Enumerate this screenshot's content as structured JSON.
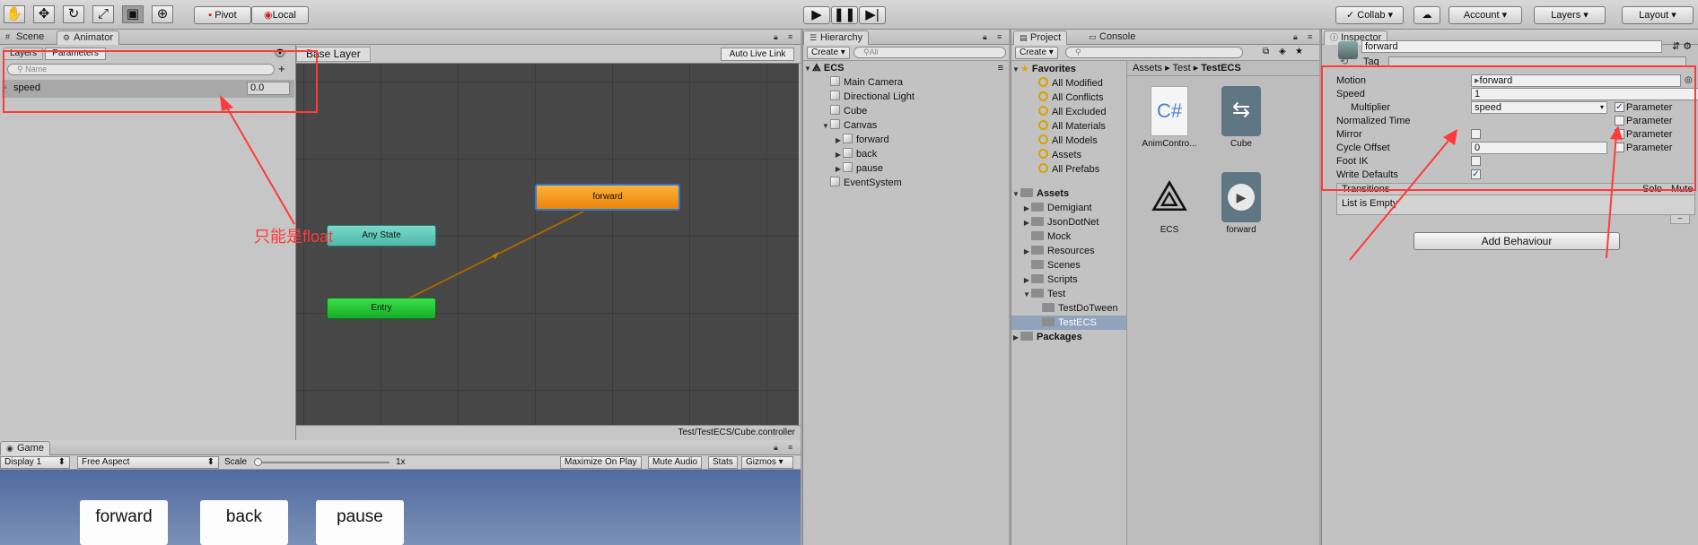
{
  "toolbar": {
    "tools": [
      "hand-tool",
      "move-tool",
      "rotate-tool",
      "scale-tool",
      "rect-tool",
      "transform-tool"
    ],
    "pivot": "Pivot",
    "local": "Local",
    "collab": "Collab",
    "account": "Account",
    "layers": "Layers",
    "layout": "Layout"
  },
  "left_tabs": {
    "scene": "Scene",
    "animator": "Animator"
  },
  "animator": {
    "layers_tab": "Layers",
    "parameters_tab": "Parameters",
    "search_placeholder": "Name",
    "param_name": "speed",
    "param_value": "0.0",
    "breadcrumb": "Base Layer",
    "auto_live_link": "Auto Live Link",
    "states": {
      "forward": "forward",
      "any_state": "Any State",
      "entry": "Entry"
    },
    "footer_path": "Test/TestECS/Cube.controller",
    "annotation": "只能是float"
  },
  "game": {
    "tab": "Game",
    "display": "Display 1",
    "aspect": "Free Aspect",
    "scale_label": "Scale",
    "scale_value": "1x",
    "maximize": "Maximize On Play",
    "mute": "Mute Audio",
    "stats": "Stats",
    "gizmos": "Gizmos",
    "buttons": [
      "forward",
      "back",
      "pause"
    ]
  },
  "hierarchy": {
    "tab": "Hierarchy",
    "create": "Create",
    "search_placeholder": "All",
    "scene": "ECS",
    "items": [
      "Main Camera",
      "Directional Light",
      "Cube",
      "Canvas",
      "forward",
      "back",
      "pause",
      "EventSystem"
    ]
  },
  "project": {
    "tab": "Project",
    "console_tab": "Console",
    "create": "Create",
    "favorites": "Favorites",
    "fav_items": [
      "All Modified",
      "All Conflicts",
      "All Excluded",
      "All Materials",
      "All Models",
      "Assets",
      "All Prefabs"
    ],
    "assets": "Assets",
    "asset_folders": [
      "Demigiant",
      "JsonDotNet",
      "Mock",
      "Resources",
      "Scenes",
      "Scripts",
      "Test"
    ],
    "test_children": [
      "TestDoTween",
      "TestECS"
    ],
    "packages": "Packages",
    "breadcrumb": [
      "Assets",
      "Test",
      "TestECS"
    ],
    "grid_items": [
      "AnimContro...",
      "Cube",
      "ECS",
      "forward"
    ]
  },
  "inspector": {
    "tab": "Inspector",
    "name": "forward",
    "tag_label": "Tag",
    "motion_label": "Motion",
    "motion_value": "forward",
    "speed_label": "Speed",
    "speed_value": "1",
    "multiplier_label": "Multiplier",
    "multiplier_value": "speed",
    "normalized_time_label": "Normalized Time",
    "mirror_label": "Mirror",
    "cycle_offset_label": "Cycle Offset",
    "cycle_offset_value": "0",
    "parameter_label": "Parameter",
    "foot_ik_label": "Foot IK",
    "write_defaults_label": "Write Defaults",
    "transitions_label": "Transitions",
    "solo_label": "Solo",
    "mute_label": "Mute",
    "list_empty": "List is Empty",
    "add_behaviour": "Add Behaviour"
  },
  "colors": {
    "accent_red": "#ff3a3a",
    "state_orange": "#f39c12",
    "state_teal": "#5fc8b9",
    "state_green": "#22c331"
  }
}
